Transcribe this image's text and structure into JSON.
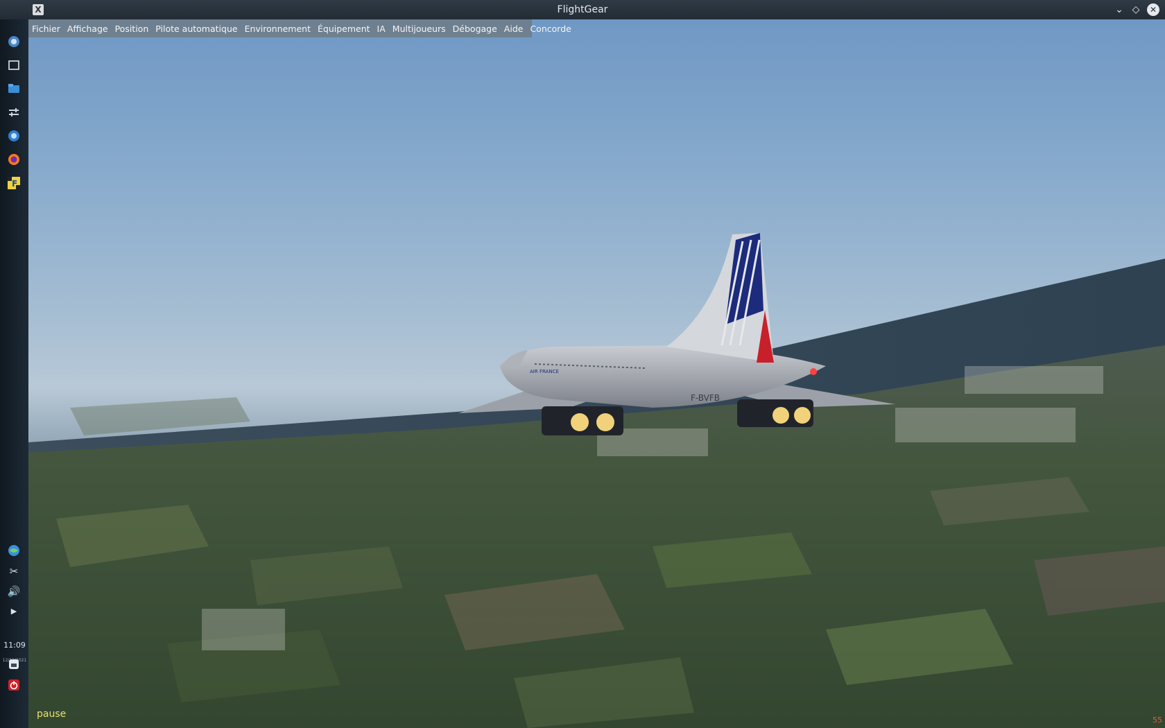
{
  "window": {
    "title": "FlightGear"
  },
  "menu": {
    "items": [
      "Fichier",
      "Affichage",
      "Position",
      "Pilote automatique",
      "Environnement",
      "Équipement",
      "IA",
      "Multijoueurs",
      "Débogage",
      "Aide",
      "Concorde"
    ]
  },
  "dock": {
    "icons": [
      "kde-menu-icon",
      "desktop-icon",
      "file-manager-icon",
      "settings-icon",
      "system-settings-icon",
      "firefox-icon",
      "flightgear-icon"
    ],
    "tray_icons": [
      "network-icon",
      "scissors-icon",
      "volume-icon",
      "expand-arrow-icon"
    ],
    "clock": "11:09",
    "date": "12/12/2021",
    "bottom_icons": [
      "lock-icon",
      "power-icon"
    ]
  },
  "aircraft": {
    "registration": "F-BVFB",
    "livery_text": "AIR FRANCE"
  },
  "hud": {
    "status": "pause",
    "fps": "55"
  },
  "colors": {
    "livery_blue": "#1c2b7c",
    "livery_red": "#c8202a",
    "pause_text": "#e8e070"
  }
}
